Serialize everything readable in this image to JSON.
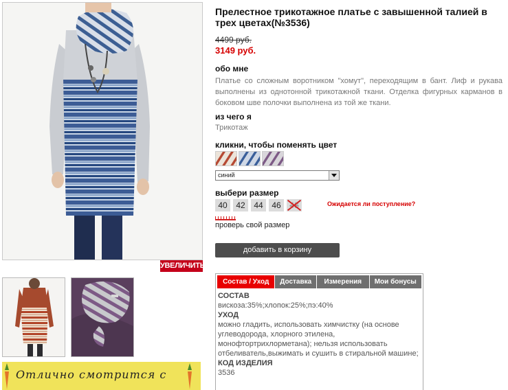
{
  "product": {
    "title": "Прелестное трикотажное платье с завышенной талией в трех цветах(№3536)",
    "price_old": "4499 руб.",
    "price_new": "3149 руб.",
    "zoom_label": "УВЕЛИЧИТЬ"
  },
  "about": {
    "title": "обо мне",
    "text": "Платье со сложным воротником \"хомут\", переходящим в бант. Лиф и рукава выполнены из однотонной трикотажной ткани. Отделка фигурных карманов в боковом шве полочки выполнена из той же ткани."
  },
  "material": {
    "title": "из чего я",
    "text": "Трикотаж"
  },
  "color": {
    "title": "кликни, чтобы поменять цвет",
    "selected": "синий",
    "swatches": [
      "red-stripe-swatch",
      "blue-stripe-swatch",
      "purple-stripe-swatch"
    ]
  },
  "size": {
    "title": "выбери размер",
    "options": [
      "40",
      "42",
      "44",
      "46",
      "48"
    ],
    "unavailable": [
      "48"
    ],
    "await_label": "Ожидается ли поступление?",
    "check_label": "проверь свой размер"
  },
  "cart": {
    "label": "добавить в корзину"
  },
  "tabs": {
    "items": [
      "Состав / Уход",
      "Доставка",
      "Измерения",
      "Мои бонусы"
    ],
    "active": "Состав / Уход",
    "composition_title": "СОСТАВ",
    "composition_text": "вискоза:35%;хлопок:25%;пэ:40%",
    "care_title": "УХОД",
    "care_text": "можно гладить, использовать химчистку (на основе углеводорода, хлорного этилена, монофтортрихлорметана); нельзя использовать отбеливатель,выжимать и сушить в стиральной машине;",
    "code_title": "КОД ИЗДЕЛИЯ",
    "code_text": "3536"
  },
  "banner": {
    "text": "Отлично смотрится с"
  },
  "colors": {
    "accent_red": "#e80000",
    "price_red": "#d60000",
    "tab_gray": "#6f6f6f",
    "button_dark": "#4d4d4d",
    "banner_yellow": "#f0e35a",
    "stripe_blue": "#3a5f9a",
    "stripe_light": "#c7d3e3"
  }
}
